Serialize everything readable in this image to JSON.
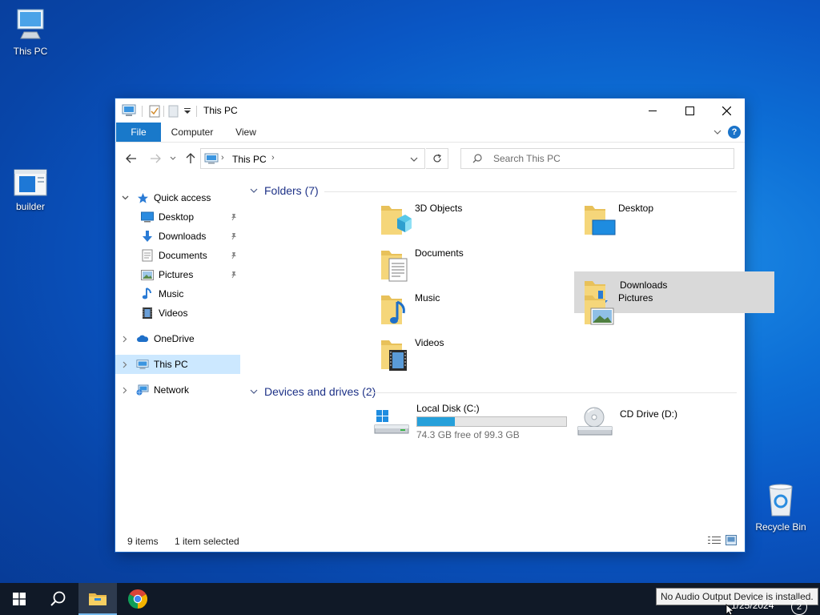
{
  "desktop": {
    "icons": [
      {
        "label": "This PC"
      },
      {
        "label": "builder"
      },
      {
        "label": "Recycle Bin"
      }
    ]
  },
  "window": {
    "title": "This PC",
    "ribbon_tabs": [
      "File",
      "Computer",
      "View"
    ],
    "address": {
      "crumb": "This PC"
    },
    "search_placeholder": "Search This PC"
  },
  "nav_pane": {
    "quick_access": "Quick access",
    "quick_items": [
      {
        "label": "Desktop",
        "icon": "desktop-icon",
        "pinned": true
      },
      {
        "label": "Downloads",
        "icon": "downloads-icon",
        "pinned": true
      },
      {
        "label": "Documents",
        "icon": "documents-icon",
        "pinned": true
      },
      {
        "label": "Pictures",
        "icon": "pictures-icon",
        "pinned": true
      },
      {
        "label": "Music",
        "icon": "music-icon",
        "pinned": false
      },
      {
        "label": "Videos",
        "icon": "videos-icon",
        "pinned": false
      }
    ],
    "onedrive": "OneDrive",
    "this_pc": "This PC",
    "network": "Network"
  },
  "content": {
    "folders_header": "Folders (7)",
    "folders": [
      {
        "name": "3D Objects"
      },
      {
        "name": "Desktop"
      },
      {
        "name": "Documents"
      },
      {
        "name": "Downloads",
        "selected": true
      },
      {
        "name": "Music"
      },
      {
        "name": "Pictures"
      },
      {
        "name": "Videos"
      }
    ],
    "drives_header": "Devices and drives (2)",
    "drives": [
      {
        "name": "Local Disk (C:)",
        "free_text": "74.3 GB free of 99.3 GB",
        "used_fraction": 0.252
      },
      {
        "name": "CD Drive (D:)"
      }
    ]
  },
  "status": {
    "items": "9 items",
    "selected": "1 item selected"
  },
  "taskbar": {
    "tooltip": "No Audio Output Device is installed.",
    "clock_date": "1/25/2024",
    "notification_count": "2"
  },
  "colors": {
    "accent": "#1979ca",
    "selection": "#cce8ff",
    "header_text": "#1e3287"
  }
}
